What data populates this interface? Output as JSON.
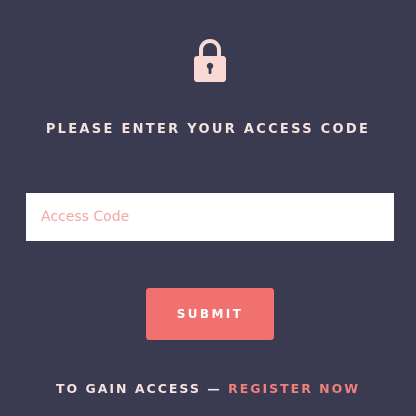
{
  "icons": {
    "lock": "lock-icon"
  },
  "colors": {
    "background": "#3a3a50",
    "accent": "#f0716f",
    "heading_text": "#f6e3df",
    "placeholder": "#f3a6a2"
  },
  "form": {
    "heading": "PLEASE ENTER YOUR ACCESS CODE",
    "input_placeholder": "Access Code",
    "input_value": "",
    "submit_label": "SUBMIT"
  },
  "footer": {
    "prefix": "TO GAIN ACCESS —",
    "link_label": "REGISTER NOW"
  }
}
